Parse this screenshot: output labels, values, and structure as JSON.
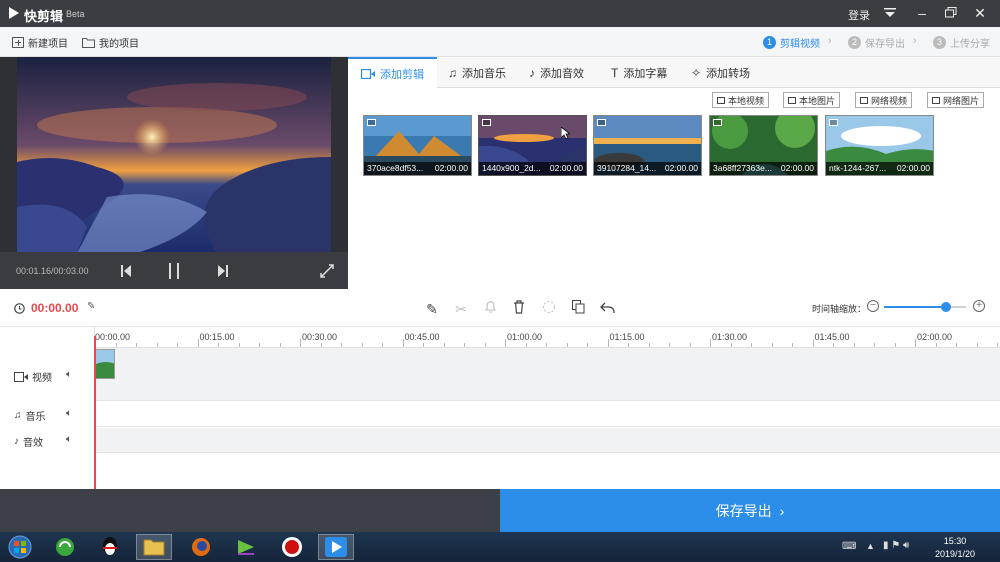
{
  "app": {
    "title": "快剪辑",
    "beta": "Beta",
    "login": "登录"
  },
  "toolbar": {
    "new_project": "新建项目",
    "my_projects": "我的项目",
    "steps": [
      {
        "num": "1",
        "label": "剪辑视频"
      },
      {
        "num": "2",
        "label": "保存导出"
      },
      {
        "num": "3",
        "label": "上传分享"
      }
    ]
  },
  "preview": {
    "time": "00:01.16/00:03.00"
  },
  "tabs": [
    "添加剪辑",
    "添加音乐",
    "添加音效",
    "添加字幕",
    "添加转场"
  ],
  "source_buttons": [
    "本地视频",
    "本地图片",
    "网络视频",
    "网络图片"
  ],
  "media": [
    {
      "name": "370ace8df53...",
      "duration": "02:00.00"
    },
    {
      "name": "1440x900_2d...",
      "duration": "02:00.00"
    },
    {
      "name": "39107284_14...",
      "duration": "02:00.00"
    },
    {
      "name": "3a68ff27363e...",
      "duration": "02:00.00"
    },
    {
      "name": "ntk-1244-267...",
      "duration": "02:00.00"
    }
  ],
  "timeline": {
    "current_time": "00:00.00",
    "zoom_label": "时间轴缩放：",
    "zoom_level": 0.75,
    "ticks": [
      "00:00.00",
      "00:15.00",
      "00:30.00",
      "00:45.00",
      "01:00.00",
      "01:15.00",
      "01:30.00",
      "01:45.00",
      "02:00.00"
    ],
    "tracks": {
      "video": "视频",
      "music": "音乐",
      "effects": "音效"
    }
  },
  "export_label": "保存导出",
  "clock": {
    "time": "15:30",
    "date": "2019/1/20"
  },
  "colors": {
    "accent": "#2c8ee8",
    "titlebar": "#3a3d42",
    "playhead": "#e64a4a"
  }
}
